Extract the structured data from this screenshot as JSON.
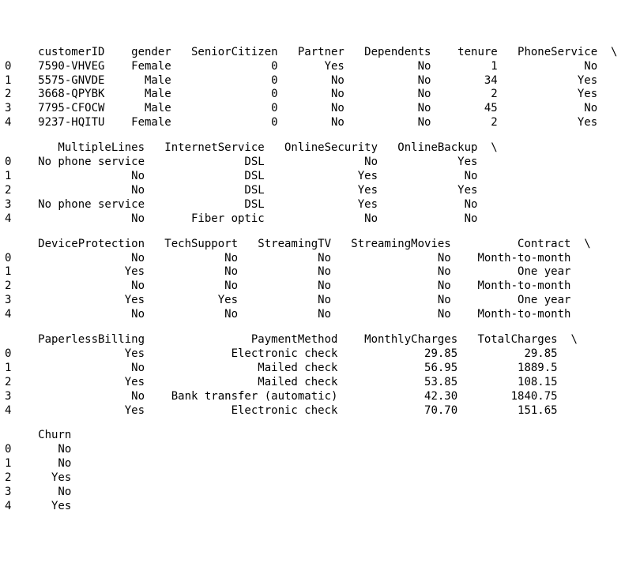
{
  "index": [
    0,
    1,
    2,
    3,
    4
  ],
  "continuation": "\\",
  "columns": [
    "customerID",
    "gender",
    "SeniorCitizen",
    "Partner",
    "Dependents",
    "tenure",
    "PhoneService",
    "MultipleLines",
    "InternetService",
    "OnlineSecurity",
    "OnlineBackup",
    "DeviceProtection",
    "TechSupport",
    "StreamingTV",
    "StreamingMovies",
    "Contract",
    "PaperlessBilling",
    "PaymentMethod",
    "MonthlyCharges",
    "TotalCharges",
    "Churn"
  ],
  "rows": [
    {
      "customerID": "7590-VHVEG",
      "gender": "Female",
      "SeniorCitizen": "0",
      "Partner": "Yes",
      "Dependents": "No",
      "tenure": "1",
      "PhoneService": "No",
      "MultipleLines": "No phone service",
      "InternetService": "DSL",
      "OnlineSecurity": "No",
      "OnlineBackup": "Yes",
      "DeviceProtection": "No",
      "TechSupport": "No",
      "StreamingTV": "No",
      "StreamingMovies": "No",
      "Contract": "Month-to-month",
      "PaperlessBilling": "Yes",
      "PaymentMethod": "Electronic check",
      "MonthlyCharges": "29.85",
      "TotalCharges": "29.85",
      "Churn": "No"
    },
    {
      "customerID": "5575-GNVDE",
      "gender": "Male",
      "SeniorCitizen": "0",
      "Partner": "No",
      "Dependents": "No",
      "tenure": "34",
      "PhoneService": "Yes",
      "MultipleLines": "No",
      "InternetService": "DSL",
      "OnlineSecurity": "Yes",
      "OnlineBackup": "No",
      "DeviceProtection": "Yes",
      "TechSupport": "No",
      "StreamingTV": "No",
      "StreamingMovies": "No",
      "Contract": "One year",
      "PaperlessBilling": "No",
      "PaymentMethod": "Mailed check",
      "MonthlyCharges": "56.95",
      "TotalCharges": "1889.5",
      "Churn": "No"
    },
    {
      "customerID": "3668-QPYBK",
      "gender": "Male",
      "SeniorCitizen": "0",
      "Partner": "No",
      "Dependents": "No",
      "tenure": "2",
      "PhoneService": "Yes",
      "MultipleLines": "No",
      "InternetService": "DSL",
      "OnlineSecurity": "Yes",
      "OnlineBackup": "Yes",
      "DeviceProtection": "No",
      "TechSupport": "No",
      "StreamingTV": "No",
      "StreamingMovies": "No",
      "Contract": "Month-to-month",
      "PaperlessBilling": "Yes",
      "PaymentMethod": "Mailed check",
      "MonthlyCharges": "53.85",
      "TotalCharges": "108.15",
      "Churn": "Yes"
    },
    {
      "customerID": "7795-CFOCW",
      "gender": "Male",
      "SeniorCitizen": "0",
      "Partner": "No",
      "Dependents": "No",
      "tenure": "45",
      "PhoneService": "No",
      "MultipleLines": "No phone service",
      "InternetService": "DSL",
      "OnlineSecurity": "Yes",
      "OnlineBackup": "No",
      "DeviceProtection": "Yes",
      "TechSupport": "Yes",
      "StreamingTV": "No",
      "StreamingMovies": "No",
      "Contract": "One year",
      "PaperlessBilling": "No",
      "PaymentMethod": "Bank transfer (automatic)",
      "MonthlyCharges": "42.30",
      "TotalCharges": "1840.75",
      "Churn": "No"
    },
    {
      "customerID": "9237-HQITU",
      "gender": "Female",
      "SeniorCitizen": "0",
      "Partner": "No",
      "Dependents": "No",
      "tenure": "2",
      "PhoneService": "Yes",
      "MultipleLines": "No",
      "InternetService": "Fiber optic",
      "OnlineSecurity": "No",
      "OnlineBackup": "No",
      "DeviceProtection": "No",
      "TechSupport": "No",
      "StreamingTV": "No",
      "StreamingMovies": "No",
      "Contract": "Month-to-month",
      "PaperlessBilling": "Yes",
      "PaymentMethod": "Electronic check",
      "MonthlyCharges": "70.70",
      "TotalCharges": "151.65",
      "Churn": "Yes"
    }
  ],
  "blocks": [
    {
      "cols": [
        "customerID",
        "gender",
        "SeniorCitizen",
        "Partner",
        "Dependents",
        "tenure",
        "PhoneService"
      ],
      "widths": [
        12,
        8,
        14,
        8,
        11,
        8,
        13
      ],
      "cont": true,
      "indexWidth": 1
    },
    {
      "cols": [
        "MultipleLines",
        "InternetService",
        "OnlineSecurity",
        "OnlineBackup"
      ],
      "widths": [
        18,
        16,
        15,
        13
      ],
      "cont": true,
      "indexWidth": 1
    },
    {
      "cols": [
        "DeviceProtection",
        "TechSupport",
        "StreamingTV",
        "StreamingMovies",
        "Contract"
      ],
      "widths": [
        18,
        12,
        12,
        16,
        16
      ],
      "cont": true,
      "indexWidth": 1
    },
    {
      "cols": [
        "PaperlessBilling",
        "PaymentMethod",
        "MonthlyCharges",
        "TotalCharges"
      ],
      "widths": [
        18,
        27,
        16,
        13
      ],
      "cont": true,
      "indexWidth": 1
    },
    {
      "cols": [
        "Churn"
      ],
      "widths": [
        7
      ],
      "cont": false,
      "indexWidth": 1
    }
  ]
}
